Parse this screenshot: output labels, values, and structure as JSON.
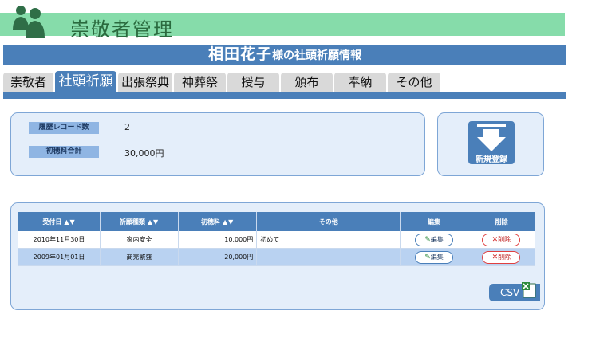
{
  "app": {
    "title": "崇敬者管理"
  },
  "banner": {
    "person_name": "相田花子",
    "suffix": "様の社頭祈願情報"
  },
  "tabs": [
    {
      "label": "崇敬者",
      "active": false
    },
    {
      "label": "社頭祈願",
      "active": true
    },
    {
      "label": "出張祭典",
      "active": false
    },
    {
      "label": "神葬祭",
      "active": false
    },
    {
      "label": "授与",
      "active": false
    },
    {
      "label": "頒布",
      "active": false
    },
    {
      "label": "奉納",
      "active": false
    },
    {
      "label": "その他",
      "active": false
    }
  ],
  "summary": {
    "record_count_label": "履歴レコード数",
    "record_count_value": "2",
    "total_label": "初穂料合計",
    "total_value": "30,000円"
  },
  "register": {
    "label": "新規登録"
  },
  "table": {
    "sort_arrows": "▲▼",
    "headers": {
      "date": "受付日",
      "type": "祈願種類",
      "fee": "初穂料",
      "other": "その他",
      "edit": "編集",
      "delete": "削除"
    },
    "rows": [
      {
        "date": "2010年11月30日",
        "type": "家内安全",
        "fee": "10,000円",
        "other": "初めて",
        "edit": "編集",
        "delete": "削除"
      },
      {
        "date": "2009年01月01日",
        "type": "商売繁盛",
        "fee": "20,000円",
        "other": "",
        "edit": "編集",
        "delete": "削除"
      }
    ]
  },
  "csv": {
    "label": "CSV"
  },
  "colors": {
    "header_green": "#86dcaa",
    "accent_blue": "#4a7fb9",
    "panel_bg": "#e4eefa",
    "selected_row": "#b9d2f1",
    "delete_red": "#e04040"
  }
}
